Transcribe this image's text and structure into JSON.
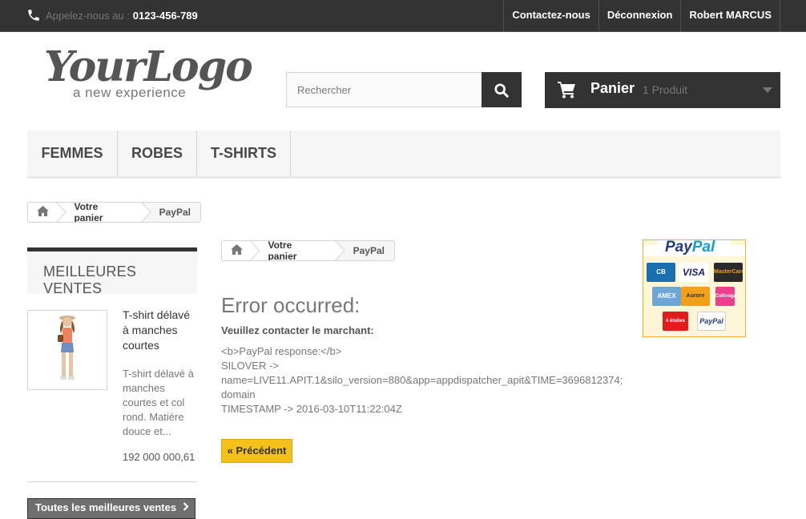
{
  "topbar": {
    "phone_label": "Appelez-nous au :",
    "phone_number": "0123-456-789",
    "links": [
      "Contactez-nous",
      "Déconnexion",
      "Robert MARCUS"
    ]
  },
  "logo": {
    "title": "YourLogo",
    "tagline": "a new experience"
  },
  "search": {
    "placeholder": "Rechercher"
  },
  "cart": {
    "label": "Panier",
    "count": "1 Produit"
  },
  "menu": {
    "items": [
      "FEMMES",
      "ROBES",
      "T-SHIRTS"
    ]
  },
  "breadcrumb": {
    "link": "Votre panier",
    "current": "PayPal"
  },
  "sidebar": {
    "title": "MEILLEURES VENTES",
    "product": {
      "name": "T-shirt délavé à manches courtes",
      "description": "T-shirt délavé à manches courtes et col rond. Matière douce et...",
      "price": "192 000 000,61"
    },
    "all_button": "Toutes les meilleures ventes"
  },
  "error": {
    "title": "Error occurred:",
    "contact": "Veuillez contacter le marchant:",
    "lines": [
      "<b>PayPal response:</b>",
      "SILOVER ->",
      "name=LIVE11.APIT.1&silo_version=880&app=appdispatcher_apit&TIME=3696812374;",
      "domain",
      "TIMESTAMP -> 2016-03-10T11:22:04Z"
    ],
    "back_button": "« Précédent"
  },
  "paypal_badge": {
    "brand_1": "Pay",
    "brand_2": "Pal",
    "cards": [
      "CB",
      "VISA",
      "MasterCard",
      "AMEX",
      "Aurore",
      "Cofinoga",
      "4 étoiles",
      "PayPal"
    ]
  },
  "colors": {
    "dark": "#333333",
    "accent": "#f4c01a",
    "menu_bg": "#f6f6f6"
  }
}
